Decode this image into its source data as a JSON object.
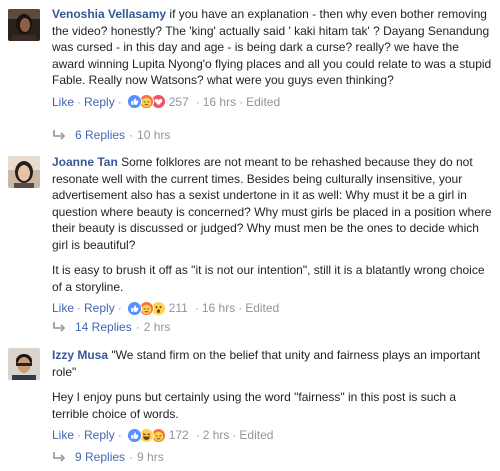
{
  "comments": [
    {
      "author": "Venoshia Vellasamy",
      "paragraphs": [
        " if you have an explanation - then why even bother removing the video? honestly? The 'king' actually said ' kaki hitam tak' ? Dayang Senandung was cursed - in this day and age - is being dark a curse? really? we have the award winning Lupita Nyong'o flying places and all you could relate to was a stupid Fable. Really now Watsons? what were you guys even thinking?"
      ],
      "like_label": "Like",
      "reply_label": "Reply",
      "sep": "·",
      "reaction_count": "257",
      "time": "16 hrs",
      "edited": "Edited",
      "reactions": [
        "like-icon",
        "angry-icon",
        "love-icon"
      ],
      "replies_label": "6 Replies",
      "replies_time": "10 hrs"
    },
    {
      "author": "Joanne Tan",
      "paragraphs": [
        " Some folklores are not meant to be rehashed because they do not resonate well with the current times. Besides being culturally insensitive, your advertisement also has a sexist undertone in it as well: Why must it be a girl in question where beauty is concerned? Why must girls be placed in a position where their beauty is discussed or judged? Why must men be the ones to decide which girl is beautiful?",
        "It is easy to brush it off as \"it is not our intention\", still it is a blatantly wrong choice of a storyline."
      ],
      "like_label": "Like",
      "reply_label": "Reply",
      "sep": "·",
      "reaction_count": "211",
      "time": "16 hrs",
      "edited": "Edited",
      "reactions": [
        "like-icon",
        "angry-icon",
        "surprised-icon"
      ],
      "replies_label": "14 Replies",
      "replies_time": "2 hrs"
    },
    {
      "author": "Izzy Musa",
      "paragraphs": [
        " \"We stand firm on the belief that unity and fairness plays an important role\"",
        "Hey I enjoy puns but certainly using the word \"fairness\" in this post is such a terrible choice of words."
      ],
      "like_label": "Like",
      "reply_label": "Reply",
      "sep": "·",
      "reaction_count": "172",
      "time": "2 hrs",
      "edited": "Edited",
      "reactions": [
        "like-icon",
        "haha-icon",
        "angry-icon"
      ],
      "replies_label": "9 Replies",
      "replies_time": "9 hrs"
    }
  ],
  "colors": {
    "link": "#4267b2",
    "author": "#365899",
    "meta": "#90949c",
    "text": "#1d2129",
    "like_blue": "#5890ff",
    "angry_orange": "#f7714b",
    "love_red": "#f25268",
    "yellow": "#fcd34f"
  }
}
